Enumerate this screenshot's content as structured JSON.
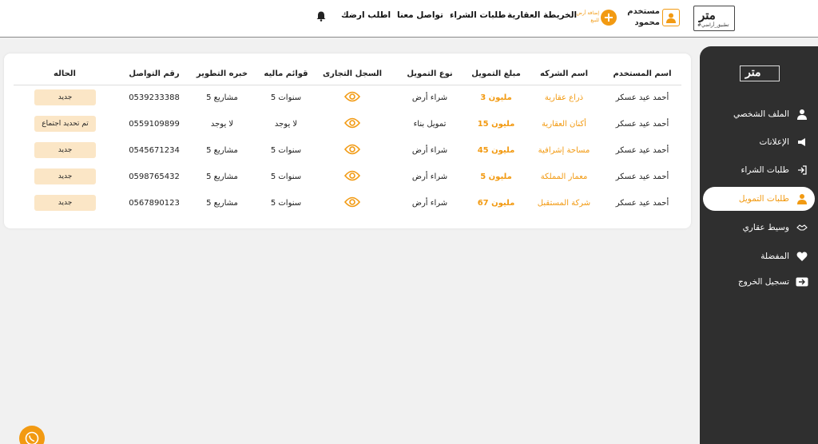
{
  "topbar": {
    "logo_text": "متر",
    "logo_tagline": "#تطبيق_أراضي",
    "user_role": "مستخدم",
    "user_name": "محمود",
    "add_label": "إضافة أرض للبيع",
    "nav": [
      "الخريطة العقارية",
      "طلبات الشراء",
      "تواصل معنا",
      "اطلب ارضك"
    ]
  },
  "sidebar": {
    "logo_text": "متر",
    "items": [
      {
        "label": "الملف الشخصي",
        "icon": "user-icon"
      },
      {
        "label": "الإعلانات",
        "icon": "megaphone-icon"
      },
      {
        "label": "طلبات الشراء",
        "icon": "sign-in-icon"
      },
      {
        "label": "طلبات التمويل",
        "icon": "user-icon",
        "active": true
      },
      {
        "label": "وسيط عقاري",
        "icon": "handshake-icon"
      },
      {
        "label": "المفضلة",
        "icon": "heart-icon"
      },
      {
        "label": "تسجيل الخروج",
        "icon": "logout-icon"
      }
    ]
  },
  "table": {
    "headers": [
      "اسم المستخدم",
      "اسم الشركه",
      "مبلغ التمويل",
      "نوع التمويل",
      "السجل التجارى",
      "قوائم ماليه",
      "خبره التطوير",
      "رقم التواصل",
      "الحاله"
    ],
    "rows": [
      {
        "user": "أحمد عيد عسكر",
        "company": "ذراع عقارية",
        "amount": "3 مليون",
        "type": "شراء أرض",
        "financial": "5 سنوات",
        "experience": "5 مشاريع",
        "phone": "0539233388",
        "status": "جديد"
      },
      {
        "user": "أحمد عيد عسكر",
        "company": "أكنان العقارية",
        "amount": "15 مليون",
        "type": "تمويل بناء",
        "financial": "لا يوجد",
        "experience": "لا يوجد",
        "phone": "0559109899",
        "status": "تم تحديد اجتماع"
      },
      {
        "user": "أحمد عيد عسكر",
        "company": "مساحة إشرافية",
        "amount": "45 مليون",
        "type": "شراء أرض",
        "financial": "5 سنوات",
        "experience": "5 مشاريع",
        "phone": "0545671234",
        "status": "جديد"
      },
      {
        "user": "أحمد عيد عسكر",
        "company": "معمار المملكة",
        "amount": "5 مليون",
        "type": "شراء أرض",
        "financial": "5 سنوات",
        "experience": "5 مشاريع",
        "phone": "0598765432",
        "status": "جديد"
      },
      {
        "user": "أحمد عيد عسكر",
        "company": "شركة المستقبل",
        "amount": "67 مليون",
        "type": "شراء أرض",
        "financial": "5 سنوات",
        "experience": "5 مشاريع",
        "phone": "0567890123",
        "status": "جديد"
      }
    ]
  },
  "colors": {
    "accent": "#f29a12",
    "sidebar_bg": "#2f2f2f",
    "badge_bg": "#fbe6c6"
  }
}
